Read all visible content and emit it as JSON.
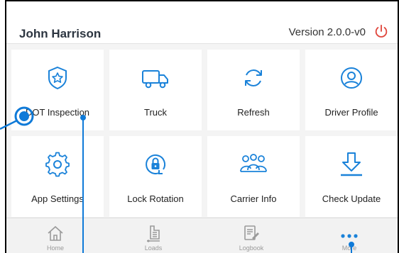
{
  "header": {
    "user_name": "John Harrison",
    "version": "Version 2.0.0-v0",
    "power_icon": "power-icon"
  },
  "tiles": [
    {
      "label": "DOT Inspection",
      "icon": "shield-star-icon"
    },
    {
      "label": "Truck",
      "icon": "truck-icon"
    },
    {
      "label": "Refresh",
      "icon": "refresh-icon"
    },
    {
      "label": "Driver Profile",
      "icon": "user-circle-icon"
    },
    {
      "label": "App Settings",
      "icon": "gear-icon"
    },
    {
      "label": "Lock Rotation",
      "icon": "lock-rotation-icon"
    },
    {
      "label": "Carrier Info",
      "icon": "people-group-icon"
    },
    {
      "label": "Check Update",
      "icon": "download-icon"
    }
  ],
  "tabs": [
    {
      "label": "Home",
      "icon": "home-icon"
    },
    {
      "label": "Loads",
      "icon": "clipboard-icon"
    },
    {
      "label": "Logbook",
      "icon": "logbook-icon"
    },
    {
      "label": "More",
      "icon": "more-dots-icon"
    }
  ],
  "colors": {
    "accent": "#1a82d9",
    "power": "#e0463c",
    "tab_icon": "#9a9a9a"
  }
}
